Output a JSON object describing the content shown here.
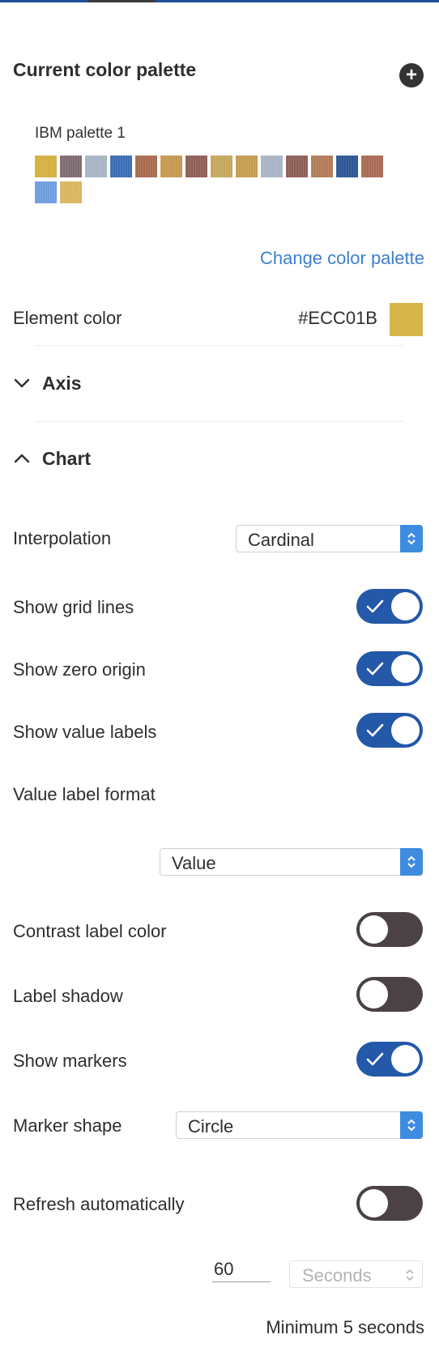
{
  "palette_section": {
    "title": "Current color palette",
    "add_icon": "plus-circle-icon",
    "palette_name": "IBM palette 1",
    "swatch_colors": [
      "#d4b040",
      "#7e6a72",
      "#a8b4c4",
      "#3a6cb4",
      "#a86a4c",
      "#c49850",
      "#8c5e56",
      "#c4a65c",
      "#c49c50",
      "#a8b4c4",
      "#8c5e56",
      "#b07a56",
      "#2c5494",
      "#a86a54",
      "#6e9ce0",
      "#d8b660"
    ],
    "change_link": "Change color palette"
  },
  "element_color": {
    "label": "Element color",
    "hex": "#ECC01B",
    "swatch_color": "#d6b64a"
  },
  "axis": {
    "label": "Axis",
    "icon": "chevron-down-icon",
    "expanded": false
  },
  "chart": {
    "label": "Chart",
    "icon": "chevron-up-icon",
    "expanded": true,
    "interpolation": {
      "label": "Interpolation",
      "value": "Cardinal"
    },
    "show_grid_lines": {
      "label": "Show grid lines",
      "on": true
    },
    "show_zero_origin": {
      "label": "Show zero origin",
      "on": true
    },
    "show_value_labels": {
      "label": "Show value labels",
      "on": true
    },
    "value_label_format": {
      "label": "Value label format",
      "value": "Value"
    },
    "contrast_label_color": {
      "label": "Contrast label color",
      "on": false
    },
    "label_shadow": {
      "label": "Label shadow",
      "on": false
    },
    "show_markers": {
      "label": "Show markers",
      "on": true
    },
    "marker_shape": {
      "label": "Marker shape",
      "value": "Circle"
    },
    "refresh_automatically": {
      "label": "Refresh automatically",
      "on": false
    },
    "refresh_interval": {
      "value": "60",
      "unit": "Seconds"
    },
    "minimum_hint": "Minimum 5 seconds"
  },
  "colors": {
    "accent": "#3d7fd0",
    "toggle_on": "#2458a8",
    "toggle_off": "#4a4245",
    "select_arrow": "#3e8ce0"
  }
}
